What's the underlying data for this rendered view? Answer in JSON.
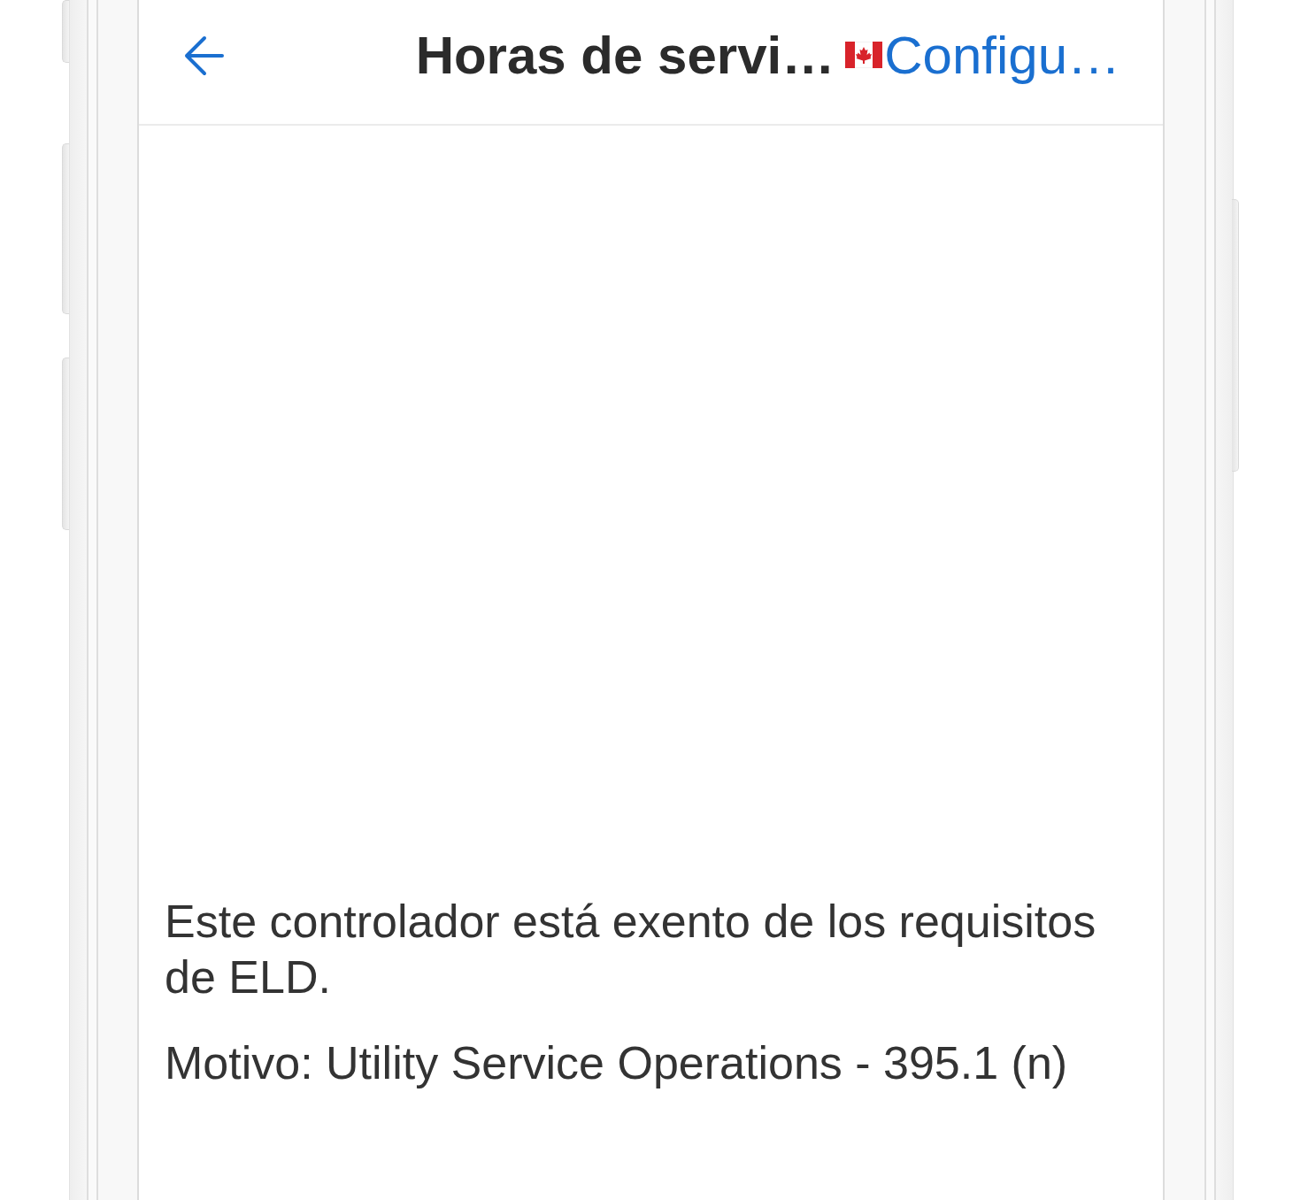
{
  "header": {
    "title": "Horas de servi…",
    "action": {
      "label": "Configu…"
    }
  },
  "body": {
    "paragraphs": [
      "Este controlador está exento de los requisitos de ELD.",
      "Motivo: Utility Service Operations - 395.1 (n)"
    ]
  }
}
